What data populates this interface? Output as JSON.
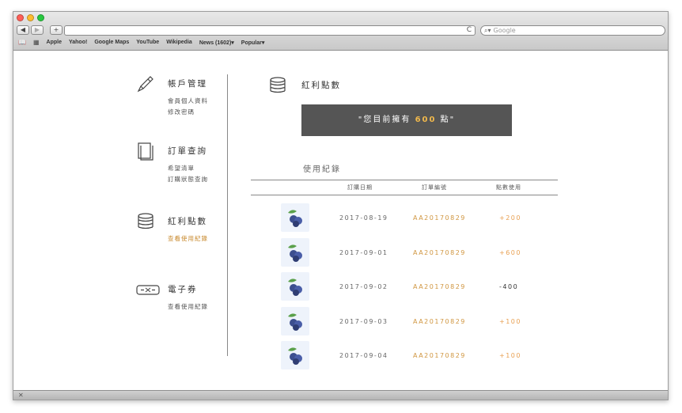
{
  "browser": {
    "back_icon": "back-arrow-icon",
    "forward_icon": "forward-arrow-icon",
    "add_icon": "plus-icon",
    "reload_glyph": "C",
    "search_placeholder": "Google",
    "bookmarks": [
      "Apple",
      "Yahoo!",
      "Google Maps",
      "YouTube",
      "Wikipedia",
      "News (1602)▾",
      "Popular▾"
    ],
    "status_glyph": "✕",
    "colors": {
      "close": "#ff5f57",
      "minimize": "#febc2e",
      "zoom": "#28c840"
    }
  },
  "sidebar": {
    "sections": [
      {
        "icon": "pencil-icon",
        "title": "帳戶管理",
        "links": [
          "會員個人資料",
          "修改密碼"
        ]
      },
      {
        "icon": "document-icon",
        "title": "訂單查詢",
        "links": [
          "希望清單",
          "訂購狀態查詢"
        ]
      },
      {
        "icon": "coins-icon",
        "title": "紅利點數",
        "links": [
          "查看使用紀錄"
        ]
      },
      {
        "icon": "ticket-icon",
        "title": "電子券",
        "links": [
          "查看使用紀錄"
        ]
      }
    ],
    "active_color": "#c88a2e"
  },
  "main": {
    "icon": "coins-icon",
    "title": "紅利點數",
    "banner": {
      "prefix": "\"您目前擁有 ",
      "points": "600",
      "suffix": " 點\""
    },
    "records_title": "使用紀錄",
    "columns": [
      "訂購日期",
      "訂單編號",
      "點數使用"
    ],
    "rows": [
      {
        "date": "2017-08-19",
        "order": "AA20170829",
        "points": "+200",
        "positive": true
      },
      {
        "date": "2017-09-01",
        "order": "AA20170829",
        "points": "+600",
        "positive": true
      },
      {
        "date": "2017-09-02",
        "order": "AA20170829",
        "points": "-400",
        "positive": false
      },
      {
        "date": "2017-09-03",
        "order": "AA20170829",
        "points": "+100",
        "positive": true
      },
      {
        "date": "2017-09-04",
        "order": "AA20170829",
        "points": "+100",
        "positive": true
      }
    ]
  }
}
